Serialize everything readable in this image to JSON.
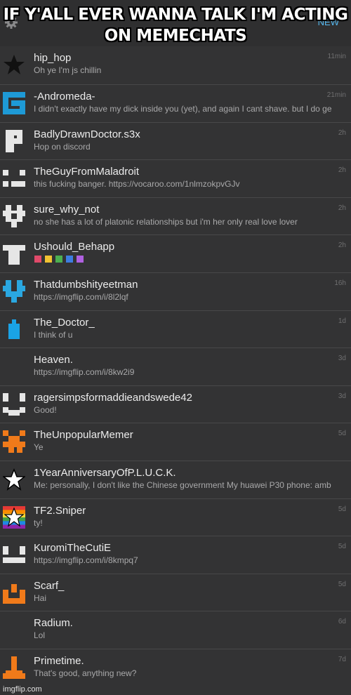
{
  "meme_caption": "IF Y'ALL EVER WANNA TALK I'M ACTING ON MEMECHATS",
  "header": {
    "new_label": "NEW",
    "settings_icon": "gear-icon"
  },
  "colors": {
    "accent": "#55b9f0",
    "background": "#333334",
    "name": "#ececec",
    "message": "#a9a9aa"
  },
  "chats": [
    {
      "name": "hip_hop",
      "message": "Oh ye I'm js chillin",
      "time": "11min",
      "avatar": "star-icon"
    },
    {
      "name": "-Andromeda-",
      "message": "I didn't exactly have my dick inside you (yet), and again I cant shave. but I do ge",
      "time": "21min",
      "avatar": "pixel-swirl-icon"
    },
    {
      "name": "BadlyDrawnDoctor.s3x",
      "message": "Hop on discord",
      "time": "2h",
      "avatar": "pixel-p-icon"
    },
    {
      "name": "TheGuyFromMaladroit",
      "message": "this fucking banger. https://vocaroo.com/1nlmzokpvGJv",
      "time": "2h",
      "avatar": "pixel-face-icon"
    },
    {
      "name": "sure_why_not",
      "message": "no she has a lot of platonic relationships but i'm her only real love lover",
      "time": "2h",
      "avatar": "pixel-heart-icon"
    },
    {
      "name": "Ushould_Behapp",
      "message": "",
      "time": "2h",
      "avatar": "pixel-shirt-icon",
      "sticker": "colorful-letters-sticker"
    },
    {
      "name": "Thatdumbshityeetman",
      "message": "https://imgflip.com/i/8l2lqf",
      "time": "16h",
      "avatar": "blue-pixel-heart-icon"
    },
    {
      "name": "The_Doctor_",
      "message": "I think of u",
      "time": "1d",
      "avatar": "blue-bottle-icon"
    },
    {
      "name": "Heaven.",
      "message": "https://imgflip.com/i/8kw2i9",
      "time": "3d",
      "avatar": ""
    },
    {
      "name": "ragersimpsformaddieandswede42",
      "message": "Good!",
      "time": "3d",
      "avatar": "pixel-smile-icon"
    },
    {
      "name": "TheUnpopularMemer",
      "message": "Ye",
      "time": "5d",
      "avatar": "orange-pixel-icon"
    },
    {
      "name": "1YearAnniversaryOfP.L.U.C.K.",
      "message": "Me: personally, I don't like the Chinese government My huawei P30 phone: amb",
      "time": "",
      "avatar": "white-star-icon"
    },
    {
      "name": "TF2.Sniper",
      "message": "ty!",
      "time": "5d",
      "avatar": "rainbow-star-icon"
    },
    {
      "name": "KuromiTheCutiE",
      "message": "https://imgflip.com/i/8kmpq7",
      "time": "5d",
      "avatar": "pixel-grin-icon"
    },
    {
      "name": "Scarf_",
      "message": "Hai",
      "time": "5d",
      "avatar": "orange-smile-icon"
    },
    {
      "name": "Radium.",
      "message": "Lol",
      "time": "6d",
      "avatar": ""
    },
    {
      "name": "Primetime.",
      "message": "That's good, anything new?",
      "time": "7d",
      "avatar": "orange-pixel-figure-icon"
    }
  ],
  "watermark": "imgflip.com"
}
